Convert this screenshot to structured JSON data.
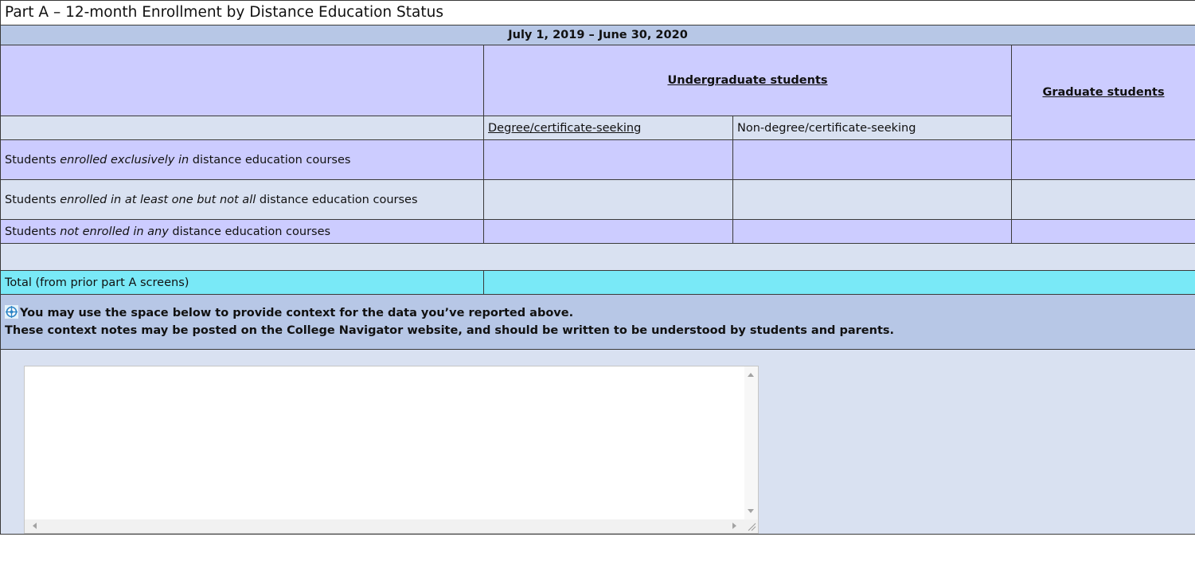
{
  "title": "Part A – 12-month Enrollment by Distance Education Status",
  "period": "July 1, 2019 – June 30, 2020",
  "headers": {
    "undergraduate": "Undergraduate students",
    "graduate": "Graduate students",
    "degree_seeking": "Degree/certificate-seeking",
    "non_degree_seeking": "Non-degree/certificate-seeking"
  },
  "rows": [
    {
      "pre": "Students ",
      "em": "enrolled exclusively in",
      "post": " distance education courses"
    },
    {
      "pre": "Students ",
      "em": "enrolled in at least one but not all",
      "post": " distance education courses"
    },
    {
      "pre": "Students ",
      "em": "not enrolled in any",
      "post": " distance education courses"
    }
  ],
  "total_label": "Total (from prior part A screens)",
  "context": {
    "line1": "You may use the space below to provide context for the data you’ve reported above.",
    "line2": "These context notes may be posted on the College Navigator website, and should be written to be understood by students and parents."
  },
  "notes": {
    "value": ""
  },
  "colors": {
    "period_band": "#b7c7e6",
    "lavender": "#ccccff",
    "light_blue": "#d9e1f1",
    "total_cyan": "#79e9f7"
  },
  "icons": {
    "help": "crosshair-help-icon"
  }
}
